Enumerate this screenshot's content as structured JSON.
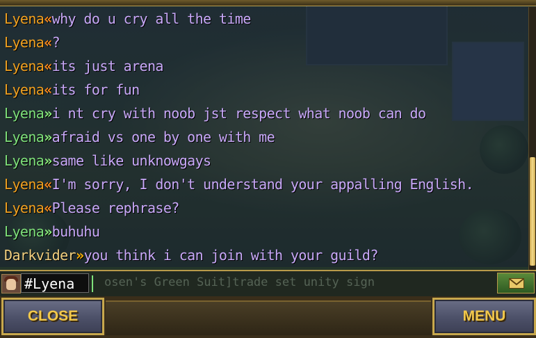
{
  "chat": {
    "messages": [
      {
        "sender": "Lyena",
        "direction": "in",
        "text": "why do u cry all the time"
      },
      {
        "sender": "Lyena",
        "direction": "in",
        "text": "?"
      },
      {
        "sender": "Lyena",
        "direction": "in",
        "text": "its just arena"
      },
      {
        "sender": "Lyena",
        "direction": "in",
        "text": "its for fun"
      },
      {
        "sender": "Lyena",
        "direction": "out",
        "text": "i nt cry with noob jst respect what noob can do"
      },
      {
        "sender": "Lyena",
        "direction": "out",
        "text": "afraid vs one by one with me"
      },
      {
        "sender": "Lyena",
        "direction": "out",
        "text": "same like unknowgays"
      },
      {
        "sender": "Lyena",
        "direction": "in",
        "text": "I'm sorry, I don't understand your appalling English."
      },
      {
        "sender": "Lyena",
        "direction": "in",
        "text": "Please rephrase?"
      },
      {
        "sender": "Lyena",
        "direction": "out",
        "text": "buhuhu"
      },
      {
        "sender": "Darkvider",
        "direction": "gold",
        "text": "you think i can join with your guild?"
      }
    ],
    "arrow_in": "«",
    "arrow_out": "»"
  },
  "input": {
    "value": "#Lyena",
    "background_text": "osen's Green Suit]trade set unity sign"
  },
  "buttons": {
    "close_label": "CLOSE",
    "menu_label": "MENU",
    "mail_icon": "envelope-icon"
  },
  "colors": {
    "incoming_arrow": "#ff8a1a",
    "outgoing_arrow": "#8cf07a",
    "message_text": "#c8a8f8",
    "button_text": "#f2c84a",
    "frame_gold": "#c8a84c"
  }
}
